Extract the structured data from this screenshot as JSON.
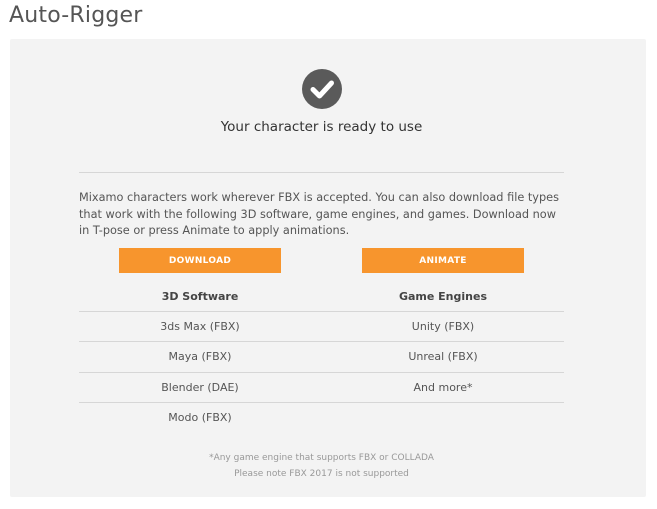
{
  "header": {
    "title": "Auto-Rigger"
  },
  "status": {
    "icon": "check-circle-icon",
    "message": "Your character is ready to use"
  },
  "description": "Mixamo characters work wherever FBX is accepted. You can also download file types that work with the following 3D software, game engines, and games. Download now in T-pose or press Animate to apply animations.",
  "actions": {
    "download_label": "DOWNLOAD",
    "animate_label": "ANIMATE"
  },
  "table": {
    "columns": [
      {
        "header": "3D Software",
        "rows": [
          "3ds Max (FBX)",
          "Maya (FBX)",
          "Blender (DAE)",
          "Modo (FBX)"
        ]
      },
      {
        "header": "Game Engines",
        "rows": [
          "Unity (FBX)",
          "Unreal (FBX)",
          "And more*"
        ]
      }
    ]
  },
  "footnotes": {
    "engine_note": "*Any game engine that supports FBX or COLLADA",
    "fbx_note": "Please note FBX 2017 is not supported"
  },
  "colors": {
    "accent": "#f7952d",
    "panel": "#f3f3f3",
    "icon": "#5a5a5a"
  }
}
